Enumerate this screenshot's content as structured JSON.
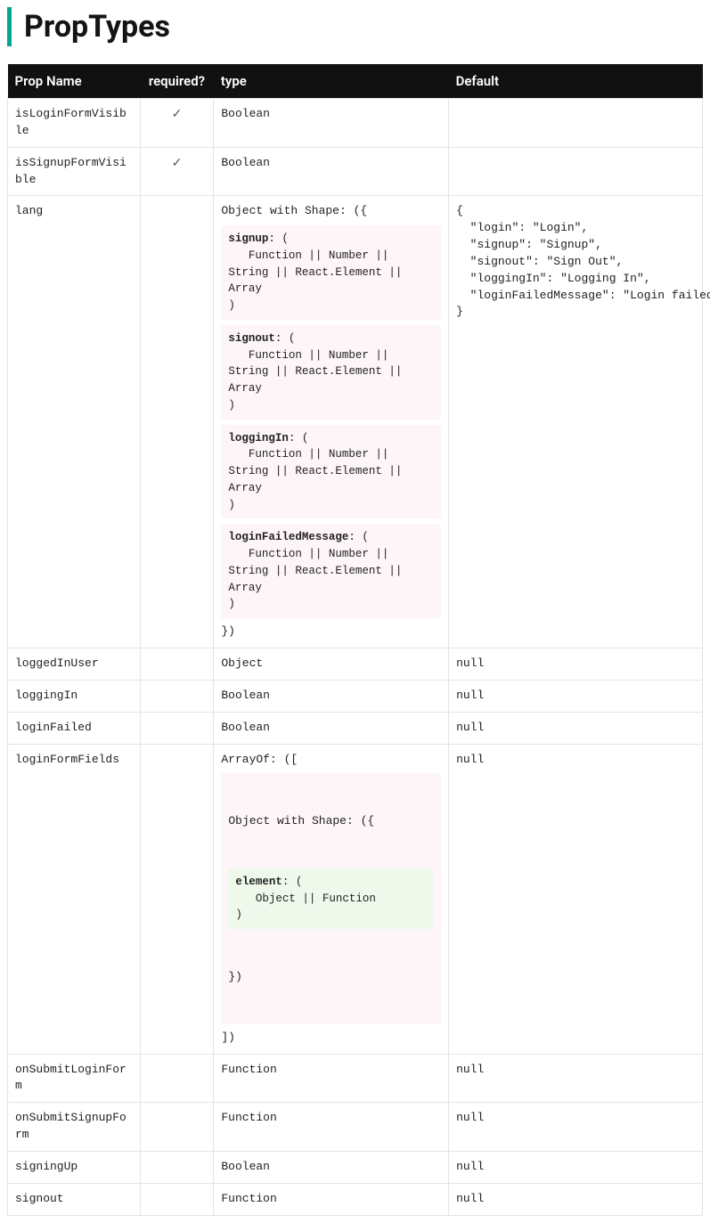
{
  "title": "PropTypes",
  "columns": {
    "name": "Prop Name",
    "required": "required?",
    "type": "type",
    "default": "Default"
  },
  "checkGlyph": "✓",
  "langTypeHeader": "Object with Shape: ({",
  "langTypeFooter": "})",
  "shapeFieldBody": "   Function || Number || String || React.Element || Array\n)",
  "arrayOfHeader": "ArrayOf: ([",
  "arrayOfInnerHeader": "Object with Shape: ({",
  "arrayOfInnerFooter": "})",
  "arrayOfFooter": "])",
  "elementFieldBody": "   Object || Function\n)",
  "rows": {
    "isLoginFormVisible": {
      "name": "isLoginFormVisible",
      "required": true,
      "type": "Boolean",
      "default": ""
    },
    "isSignupFormVisible": {
      "name": "isSignupFormVisible",
      "required": true,
      "type": "Boolean",
      "default": ""
    },
    "lang": {
      "name": "lang",
      "required": false,
      "shapeKeys": {
        "signup": "signup",
        "signout": "signout",
        "loggingIn": "loggingIn",
        "loginFailedMessage": "loginFailedMessage"
      },
      "default": "{\n  \"login\": \"Login\",\n  \"signup\": \"Signup\",\n  \"signout\": \"Sign Out\",\n  \"loggingIn\": \"Logging In\",\n  \"loginFailedMessage\": \"Login failed\"\n}"
    },
    "loggedInUser": {
      "name": "loggedInUser",
      "required": false,
      "type": "Object",
      "default": "null"
    },
    "loggingIn": {
      "name": "loggingIn",
      "required": false,
      "type": "Boolean",
      "default": "null"
    },
    "loginFailed": {
      "name": "loginFailed",
      "required": false,
      "type": "Boolean",
      "default": "null"
    },
    "loginFormFields": {
      "name": "loginFormFields",
      "required": false,
      "elementKey": "element",
      "default": "null"
    },
    "onSubmitLoginForm": {
      "name": "onSubmitLoginForm",
      "required": false,
      "type": "Function",
      "default": "null"
    },
    "onSubmitSignupForm": {
      "name": "onSubmitSignupForm",
      "required": false,
      "type": "Function",
      "default": "null"
    },
    "signingUp": {
      "name": "signingUp",
      "required": false,
      "type": "Boolean",
      "default": "null"
    },
    "signout": {
      "name": "signout",
      "required": false,
      "type": "Function",
      "default": "null"
    }
  }
}
